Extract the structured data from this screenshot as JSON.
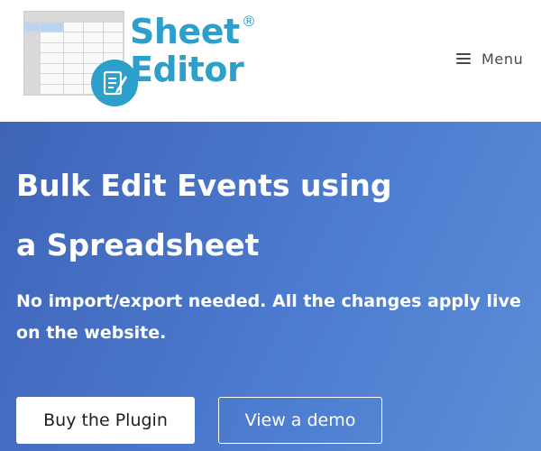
{
  "header": {
    "logo": {
      "line1": "Sheet",
      "line2": "Editor",
      "registered": "®"
    },
    "menu_label": "Menu"
  },
  "hero": {
    "title": "Bulk Edit Events using a Spreadsheet",
    "subtitle": "No import/export needed. All the changes apply live on the website.",
    "buy_label": "Buy the Plugin",
    "demo_label": "View a demo"
  },
  "colors": {
    "brand": "#2c9fcb",
    "hero_start": "#3f64b8",
    "hero_end": "#5b8ed8"
  }
}
